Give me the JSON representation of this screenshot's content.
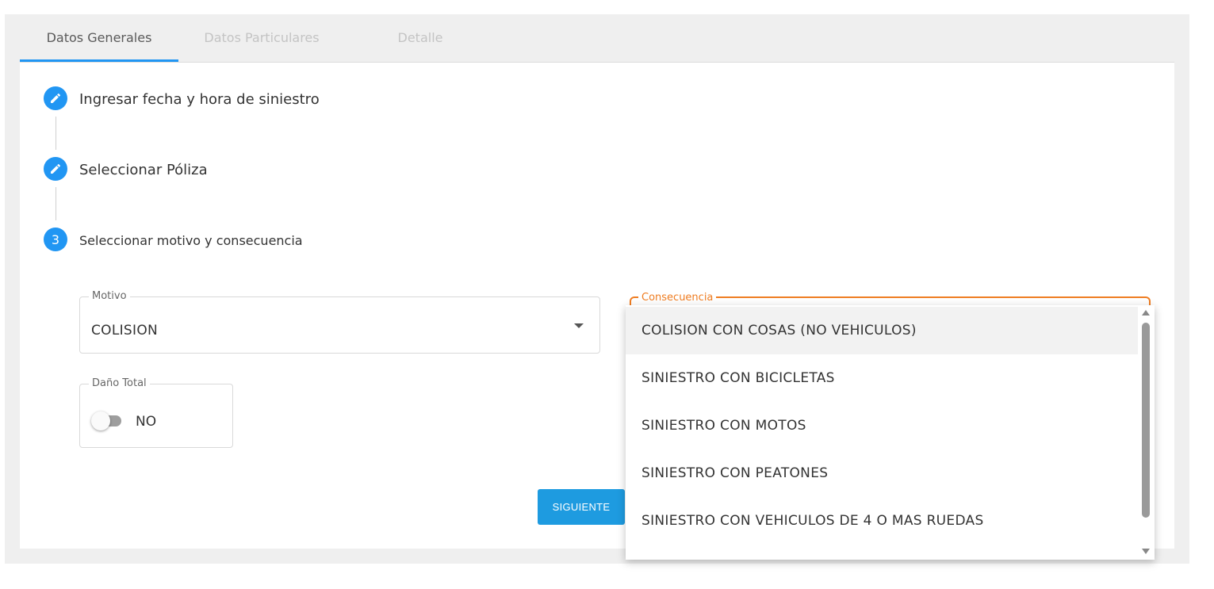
{
  "tabs": [
    {
      "label": "Datos Generales",
      "active": true
    },
    {
      "label": "Datos Particulares",
      "active": false
    },
    {
      "label": "Detalle",
      "active": false
    }
  ],
  "steps": [
    {
      "icon": "pencil-icon",
      "label": "Ingresar fecha y hora de siniestro"
    },
    {
      "icon": "pencil-icon",
      "label": "Seleccionar Póliza"
    },
    {
      "number": "3",
      "label": "Seleccionar motivo y consecuencia"
    }
  ],
  "motivo": {
    "legend": "Motivo",
    "value": "COLISION"
  },
  "dano_total": {
    "legend": "Daño Total",
    "value": "NO",
    "checked": false
  },
  "consecuencia": {
    "legend": "Consecuencia",
    "options": [
      "COLISION CON COSAS (NO VEHICULOS)",
      "SINIESTRO CON BICICLETAS",
      "SINIESTRO CON MOTOS",
      "SINIESTRO CON PEATONES",
      "SINIESTRO CON VEHICULOS DE 4 O MAS RUEDAS"
    ],
    "highlighted_index": 0
  },
  "actions": {
    "next_label": "SIGUIENTE"
  },
  "colors": {
    "primary": "#2196f3",
    "button": "#1e9be0",
    "focus": "#ef7d22"
  }
}
